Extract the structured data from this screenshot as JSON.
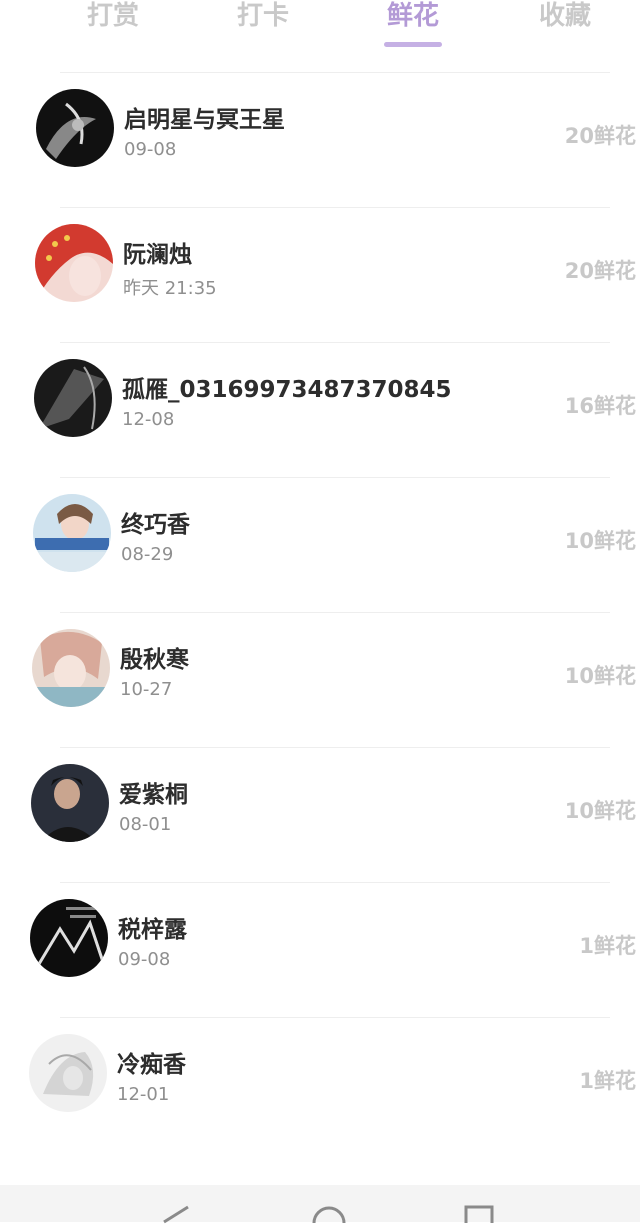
{
  "tabs": [
    {
      "label": "打赏"
    },
    {
      "label": "打卡"
    },
    {
      "label": "鲜花"
    },
    {
      "label": "收藏"
    }
  ],
  "active_tab": "鲜花",
  "colors": {
    "accent": "#b39ad6",
    "tab_inactive": "#c9c9c9",
    "name": "#2d2d2d",
    "time": "#8f8f8f",
    "count": "#c8c8c8"
  },
  "rows": [
    {
      "name": "启明星与冥王星",
      "time": "09-08",
      "count": "20鲜花"
    },
    {
      "name": "阮澜烛",
      "time": "昨天 21:35",
      "count": "20鲜花"
    },
    {
      "name": "孤雁_03169973487370845",
      "time": "12-08",
      "count": "16鲜花"
    },
    {
      "name": "终巧香",
      "time": "08-29",
      "count": "10鲜花"
    },
    {
      "name": "殷秋寒",
      "time": "10-27",
      "count": "10鲜花"
    },
    {
      "name": "爱紫桐",
      "time": "08-01",
      "count": "10鲜花"
    },
    {
      "name": "税梓露",
      "time": "09-08",
      "count": "1鲜花"
    },
    {
      "name": "冷痴香",
      "time": "12-01",
      "count": "1鲜花"
    }
  ],
  "navbar": {
    "icons": [
      "back-icon",
      "home-icon",
      "recents-icon"
    ]
  }
}
